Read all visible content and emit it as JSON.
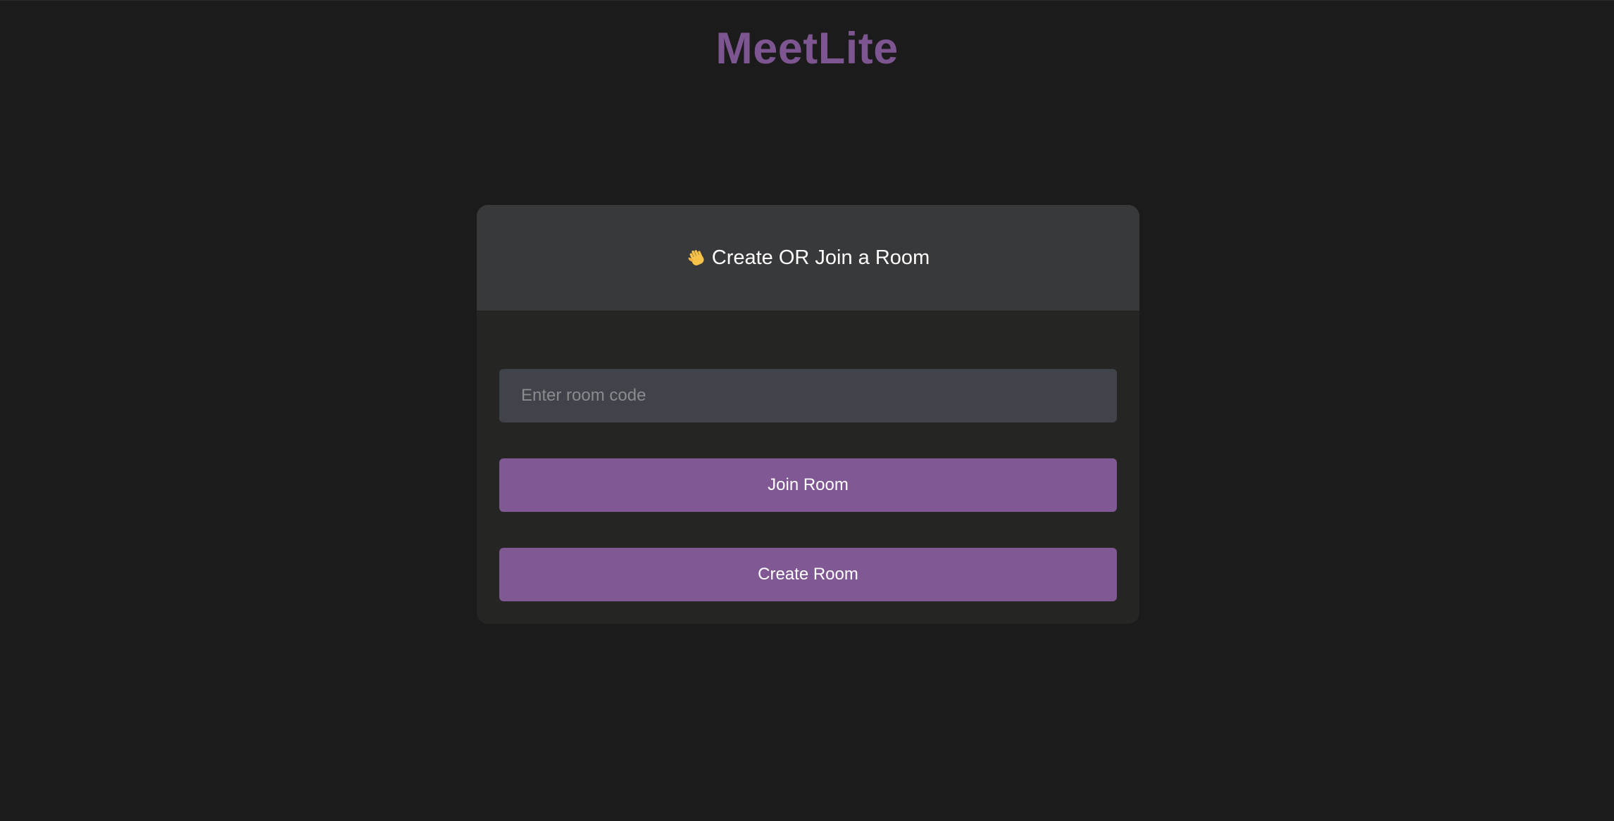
{
  "app": {
    "title": "MeetLite"
  },
  "card": {
    "heading_icon": "waving-hand-icon",
    "heading_text": "Create OR Join a Room"
  },
  "form": {
    "room_code_value": "",
    "room_code_placeholder": "Enter room code",
    "join_label": "Join Room",
    "create_label": "Create Room"
  },
  "colors": {
    "background": "#1b1b1b",
    "card_body": "#252524",
    "card_header": "#38393b",
    "input_background": "#40434a",
    "accent": "#805893",
    "text": "#ffffff"
  }
}
